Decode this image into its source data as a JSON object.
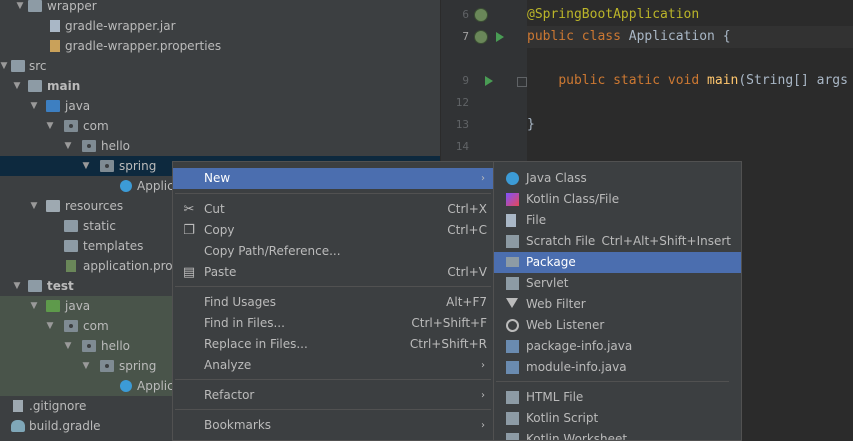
{
  "project_tree": {
    "items": [
      {
        "label": "wrapper",
        "icon": "folder-icon"
      },
      {
        "label": "gradle-wrapper.jar",
        "icon": "jar-file-icon"
      },
      {
        "label": "gradle-wrapper.properties",
        "icon": "properties-file-icon"
      },
      {
        "label": "src",
        "icon": "folder-icon"
      },
      {
        "label": "main",
        "icon": "folder-icon"
      },
      {
        "label": "java",
        "icon": "source-folder-icon"
      },
      {
        "label": "com",
        "icon": "package-icon"
      },
      {
        "label": "hello",
        "icon": "package-icon"
      },
      {
        "label": "spring",
        "icon": "package-icon"
      },
      {
        "label": "Applic",
        "icon": "spring-class-icon"
      },
      {
        "label": "resources",
        "icon": "resources-folder-icon"
      },
      {
        "label": "static",
        "icon": "folder-icon"
      },
      {
        "label": "templates",
        "icon": "folder-icon"
      },
      {
        "label": "application.prope",
        "icon": "properties-file-icon"
      },
      {
        "label": "test",
        "icon": "folder-icon"
      },
      {
        "label": "java",
        "icon": "test-source-folder-icon"
      },
      {
        "label": "com",
        "icon": "package-icon"
      },
      {
        "label": "hello",
        "icon": "package-icon"
      },
      {
        "label": "spring",
        "icon": "package-icon"
      },
      {
        "label": "Applic",
        "icon": "spring-class-icon"
      },
      {
        "label": ".gitignore",
        "icon": "gitignore-file-icon"
      },
      {
        "label": "build.gradle",
        "icon": "gradle-file-icon"
      }
    ]
  },
  "editor": {
    "line_numbers": [
      "6",
      "7",
      "9",
      "12",
      "13",
      "14"
    ],
    "annotation": "@SpringBootApplication",
    "class_decl": {
      "kw1": "public",
      "kw2": "class",
      "name": "Application",
      "brace": "{"
    },
    "main_decl": {
      "kw1": "public",
      "kw2": "static",
      "kw3": "void",
      "name": "main",
      "params": "(String[] args"
    },
    "close_brace": "}"
  },
  "context_menu": {
    "items": [
      {
        "label": "New",
        "shortcut": "",
        "submenu": true,
        "icon": ""
      },
      {
        "label": "Cut",
        "shortcut": "Ctrl+X",
        "icon": "scissors-icon"
      },
      {
        "label": "Copy",
        "shortcut": "Ctrl+C",
        "icon": "copy-icon"
      },
      {
        "label": "Copy Path/Reference...",
        "shortcut": "",
        "icon": ""
      },
      {
        "label": "Paste",
        "shortcut": "Ctrl+V",
        "icon": "clipboard-icon"
      },
      {
        "label": "Find Usages",
        "shortcut": "Alt+F7",
        "icon": ""
      },
      {
        "label": "Find in Files...",
        "shortcut": "Ctrl+Shift+F",
        "icon": ""
      },
      {
        "label": "Replace in Files...",
        "shortcut": "Ctrl+Shift+R",
        "icon": ""
      },
      {
        "label": "Analyze",
        "shortcut": "",
        "submenu": true,
        "icon": ""
      },
      {
        "label": "Refactor",
        "shortcut": "",
        "submenu": true,
        "icon": ""
      },
      {
        "label": "Bookmarks",
        "shortcut": "",
        "submenu": true,
        "icon": ""
      }
    ],
    "submenu_arrow": "›"
  },
  "new_submenu": {
    "items": [
      {
        "label": "Java Class",
        "shortcut": "",
        "icon": "java-class-icon"
      },
      {
        "label": "Kotlin Class/File",
        "shortcut": "",
        "icon": "kotlin-icon"
      },
      {
        "label": "File",
        "shortcut": "",
        "icon": "file-icon"
      },
      {
        "label": "Scratch File",
        "shortcut": "Ctrl+Alt+Shift+Insert",
        "icon": "scratch-file-icon"
      },
      {
        "label": "Package",
        "shortcut": "",
        "icon": "package-icon"
      },
      {
        "label": "Servlet",
        "shortcut": "",
        "icon": "servlet-icon"
      },
      {
        "label": "Web Filter",
        "shortcut": "",
        "icon": "filter-icon"
      },
      {
        "label": "Web Listener",
        "shortcut": "",
        "icon": "listener-icon"
      },
      {
        "label": "package-info.java",
        "shortcut": "",
        "icon": "java-file-icon"
      },
      {
        "label": "module-info.java",
        "shortcut": "",
        "icon": "java-file-icon"
      },
      {
        "label": "HTML File",
        "shortcut": "",
        "icon": "html-file-icon"
      },
      {
        "label": "Kotlin Script",
        "shortcut": "",
        "icon": "kotlin-script-icon"
      },
      {
        "label": "Kotlin Worksheet",
        "shortcut": "",
        "icon": "kotlin-worksheet-icon"
      }
    ]
  },
  "colors": {
    "accent": "#4b6eaf",
    "panel": "#3c3f41",
    "editor_bg": "#2b2b2b",
    "annotation": "#bbb529",
    "keyword": "#cc7832",
    "function": "#ffc66d"
  }
}
